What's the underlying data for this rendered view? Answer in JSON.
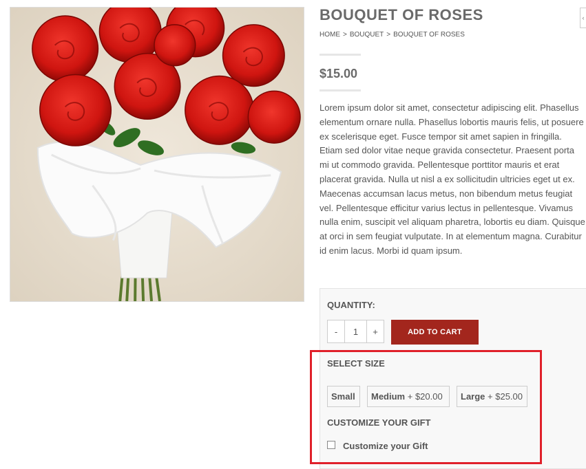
{
  "product": {
    "title": "BOUQUET OF ROSES",
    "breadcrumb": [
      "HOME",
      "BOUQUET",
      "BOUQUET OF ROSES"
    ],
    "breadcrumb_separator": ">",
    "price": "$15.00",
    "description": "Lorem ipsum dolor sit amet, consectetur adipiscing elit. Phasellus elementum ornare nulla. Phasellus lobortis mauris felis, ut posuere ex scelerisque eget. Fusce tempor sit amet sapien in fringilla. Etiam sed dolor vitae neque gravida consectetur. Praesent porta mi ut commodo gravida. Pellentesque porttitor mauris et erat placerat gravida. Nulla ut nisl a ex sollicitudin ultricies eget ut ex. Maecenas accumsan lacus metus, non bibendum metus feugiat vel. Pellentesque efficitur varius lectus in pellentesque. Vivamus nulla enim, suscipit vel aliquam pharetra, lobortis eu diam. Quisque at orci in sem feugiat vulputate. In at elementum magna. Curabitur id enim lacus. Morbi id quam ipsum."
  },
  "cart": {
    "quantity_label": "QUANTITY:",
    "minus": "-",
    "quantity_value": "1",
    "plus": "+",
    "add_to_cart_label": "ADD TO CART",
    "select_size_label": "SELECT SIZE",
    "sizes": [
      {
        "name": "Small",
        "extra": ""
      },
      {
        "name": "Medium",
        "extra": "+ $20.00"
      },
      {
        "name": "Large",
        "extra": "+ $25.00"
      }
    ],
    "customize_heading": "CUSTOMIZE YOUR GIFT",
    "customize_checkbox_label": "Customize your Gift",
    "customize_checked": false
  },
  "edge_button_icon": "chevron-left-icon",
  "colors": {
    "accent": "#a3261d",
    "highlight_box": "#e0202a"
  }
}
